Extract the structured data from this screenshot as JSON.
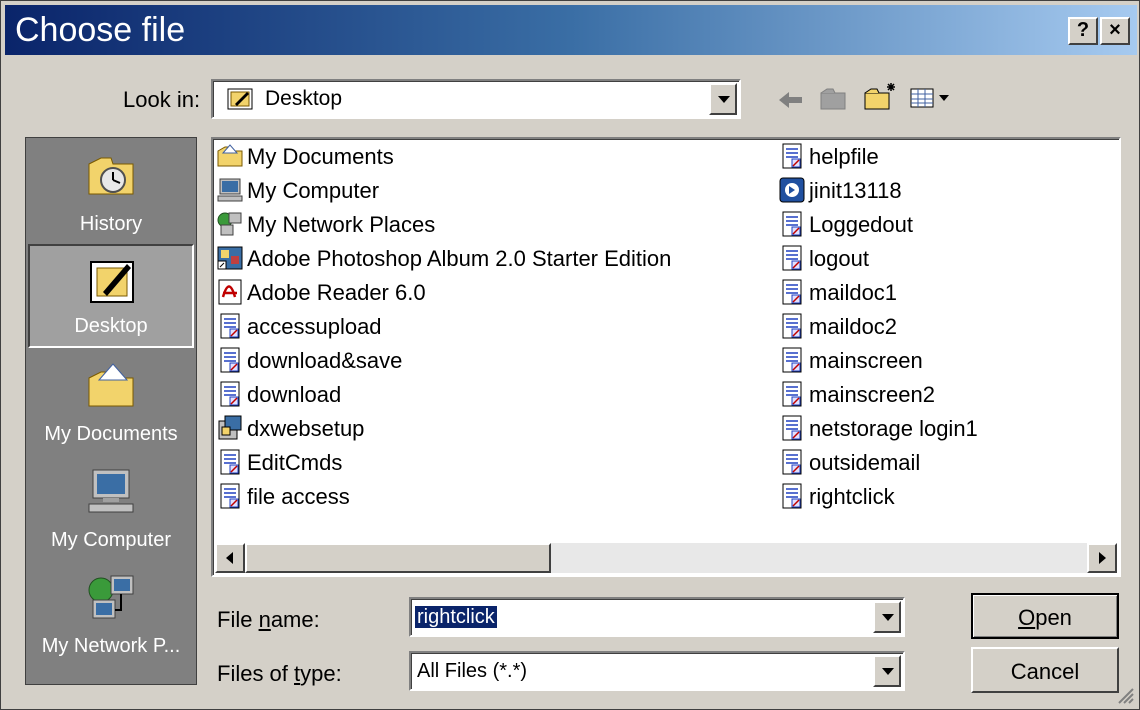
{
  "window": {
    "title": "Choose file",
    "help_btn": "?",
    "close_btn": "×"
  },
  "lookin": {
    "label": "Look in:",
    "value": "Desktop"
  },
  "places": [
    {
      "label": "History",
      "icon": "history-icon"
    },
    {
      "label": "Desktop",
      "icon": "desktop-icon"
    },
    {
      "label": "My Documents",
      "icon": "my-documents-icon"
    },
    {
      "label": "My Computer",
      "icon": "my-computer-icon"
    },
    {
      "label": "My Network P...",
      "icon": "network-places-icon"
    }
  ],
  "files_left": [
    {
      "name": "My Documents",
      "icon": "folder-icon"
    },
    {
      "name": "My Computer",
      "icon": "computer-icon"
    },
    {
      "name": "My Network Places",
      "icon": "network-icon"
    },
    {
      "name": "Adobe Photoshop Album 2.0 Starter Edition",
      "icon": "shortcut-icon"
    },
    {
      "name": "Adobe Reader 6.0",
      "icon": "pdf-icon"
    },
    {
      "name": "accessupload",
      "icon": "document-icon"
    },
    {
      "name": "download&save",
      "icon": "document-icon"
    },
    {
      "name": "download",
      "icon": "document-icon"
    },
    {
      "name": "dxwebsetup",
      "icon": "setup-icon"
    },
    {
      "name": "EditCmds",
      "icon": "document-icon"
    },
    {
      "name": "file access",
      "icon": "document-icon"
    }
  ],
  "files_right": [
    {
      "name": "helpfile",
      "icon": "document-icon"
    },
    {
      "name": "jinit13118",
      "icon": "installer-icon"
    },
    {
      "name": "Loggedout",
      "icon": "document-icon"
    },
    {
      "name": "logout",
      "icon": "document-icon"
    },
    {
      "name": "maildoc1",
      "icon": "document-icon"
    },
    {
      "name": "maildoc2",
      "icon": "document-icon"
    },
    {
      "name": "mainscreen",
      "icon": "document-icon"
    },
    {
      "name": "mainscreen2",
      "icon": "document-icon"
    },
    {
      "name": "netstorage login1",
      "icon": "document-icon"
    },
    {
      "name": "outsidemail",
      "icon": "document-icon"
    },
    {
      "name": "rightclick",
      "icon": "document-icon"
    }
  ],
  "filename": {
    "label_pre": "File ",
    "label_u": "n",
    "label_post": "ame:",
    "value": "rightclick"
  },
  "filetype": {
    "label_pre": "Files of ",
    "label_u": "t",
    "label_post": "ype:",
    "value": "All Files (*.*)"
  },
  "buttons": {
    "open_u": "O",
    "open_rest": "pen",
    "cancel": "Cancel"
  },
  "colors": {
    "titlebar_start": "#0a246a",
    "titlebar_end": "#a6caf0",
    "selection": "#0a246a"
  }
}
